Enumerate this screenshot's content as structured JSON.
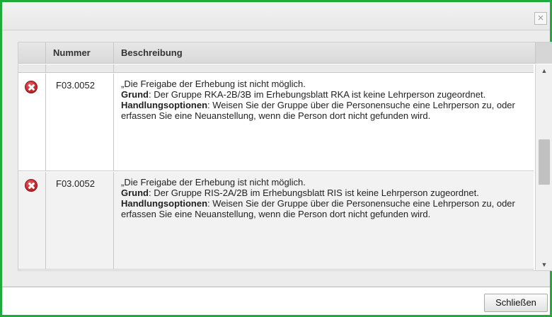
{
  "dialog": {
    "close_icon": "×",
    "close_button_label": "Schließen",
    "accent_color": "#1faa3c"
  },
  "table": {
    "columns": {
      "number": "Nummer",
      "description": "Beschreibung"
    },
    "rows": [
      {
        "icon": "error-icon",
        "number": "F03.0052",
        "message": "„Die Freigabe der Erhebung ist nicht möglich.",
        "reason_label": "Grund",
        "reason_text": ": Der Gruppe RKA-2B/3B im Erhebungsblatt RKA ist keine Lehrperson zugeordnet.",
        "options_label": "Handlungsoptionen",
        "options_text": ": Weisen Sie der Gruppe über die Personensuche eine Lehrperson zu, oder erfassen Sie eine Neuanstellung, wenn die Person dort nicht gefunden wird."
      },
      {
        "icon": "error-icon",
        "number": "F03.0052",
        "message": "„Die Freigabe der Erhebung ist nicht möglich.",
        "reason_label": "Grund",
        "reason_text": ": Der Gruppe RIS-2A/2B im Erhebungsblatt RIS ist keine Lehrperson zugeordnet.",
        "options_label": "Handlungsoptionen",
        "options_text": ": Weisen Sie der Gruppe über die Personensuche eine Lehrperson zu, oder erfassen Sie eine Neuanstellung, wenn die Person dort nicht gefunden wird."
      }
    ]
  },
  "scrollbar": {
    "up_arrow": "▲",
    "down_arrow": "▼"
  }
}
